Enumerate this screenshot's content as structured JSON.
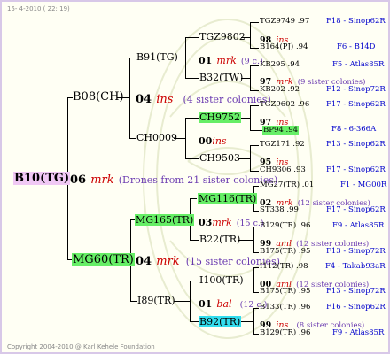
{
  "header": "15- 4-2010 ( 22: 19)",
  "footer": "Copyright 2004-2010 @ Karl Kehele Foundation",
  "root": {
    "id": "B10(TG)",
    "gen_no": "06",
    "gen_kind": "mrk",
    "note": "(Drones from 21 sister colonies)"
  },
  "paternal": {
    "id": "B08(CH)",
    "q1": {
      "id": "B91(TG)",
      "gen_no": "01",
      "gen_kind": "mrk",
      "note": "(9 c.)",
      "f": "TGZ9802",
      "f_line1": {
        "a": "TGZ9749",
        "b": ".97",
        "c": "F18 - Sinop62R"
      },
      "f_no": "98",
      "f_kind": "ins",
      "f_line2": {
        "a": "B164(PJ)",
        "b": ".94",
        "c": "F6 - B14D"
      },
      "m": "B32(TW)",
      "m_line1": {
        "a": "KB295",
        "b": ".94",
        "c": "F5 - Atlas85R"
      },
      "m_no": "97",
      "m_kind": "mrk",
      "m_note": "(9 sister colonies)",
      "m_line2": {
        "a": "KB202",
        "b": ".92",
        "c": "F12 - Sinop72R"
      }
    },
    "mid": {
      "no": "04",
      "kind": "ins",
      "note": "(4 sister colonies)"
    },
    "q2": {
      "id": "CH0009",
      "gen_no": "00",
      "gen_kind": "ins",
      "f": "CH9752",
      "f_line1": {
        "a": "TGZ9602",
        "b": ".96",
        "c": "F17 - Sinop62R"
      },
      "f_no": "97",
      "f_kind": "ins",
      "f_line2": {
        "a": "BP94",
        "b": ".94",
        "c": "F8 - 6-366A"
      },
      "m": "CH9503",
      "m_line1": {
        "a": "TGZ171",
        "b": ".92",
        "c": "F13 - Sinop62R"
      },
      "m_no": "95",
      "m_kind": "ins",
      "m_line2": {
        "a": "CH9306",
        "b": ".93",
        "c": "F17 - Sinop62R"
      }
    }
  },
  "maternal": {
    "id": "MG60(TR)",
    "mid": {
      "no": "04",
      "kind": "mrk",
      "note": "(15 sister colonies)"
    },
    "q1": {
      "id": "MG165(TR)",
      "gen_no": "03",
      "gen_kind": "mrk",
      "note": "(15 c.)",
      "f": "MG116(TR)",
      "f_line1": {
        "a": "MG27(TR)",
        "b": ".01",
        "c": "F1 - MG00R"
      },
      "f_no": "02",
      "f_kind": "mrk",
      "f_note": "(12 sister colonies)",
      "f_line2": {
        "a": "ST338",
        "b": ".99",
        "c": "F17 - Sinop62R"
      },
      "m": "B22(TR)",
      "m_line1": {
        "a": "B129(TR)",
        "b": ".96",
        "c": "F9 - Atlas85R"
      },
      "m_no": "99",
      "m_kind": "aml",
      "m_note": "(12 sister colonies)",
      "m_line2": {
        "a": "B175(TR)",
        "b": ".95",
        "c": "F13 - Sinop72R"
      }
    },
    "q2": {
      "id": "I89(TR)",
      "gen_no": "01",
      "gen_kind": "bal",
      "note": "(12 c.)",
      "f": "I100(TR)",
      "f_line1": {
        "a": "I112(TR)",
        "b": ".98",
        "c": "F4 - Takab93aR"
      },
      "f_no": "00",
      "f_kind": "aml",
      "f_note": "(12 sister colonies)",
      "f_line2": {
        "a": "B175(TR)",
        "b": ".95",
        "c": "F13 - Sinop72R"
      },
      "m": "B92(TR)",
      "m_line1": {
        "a": "B133(TR)",
        "b": ".96",
        "c": "F16 - Sinop62R"
      },
      "m_no": "99",
      "m_kind": "ins",
      "m_note": "(8 sister colonies)",
      "m_line2": {
        "a": "B129(TR)",
        "b": ".96",
        "c": "F9 - Atlas85R"
      }
    }
  }
}
